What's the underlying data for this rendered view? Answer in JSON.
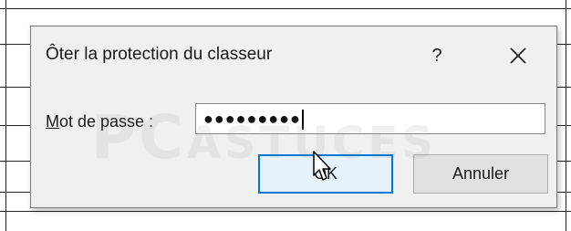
{
  "dialog": {
    "title": "Ôter la protection du classeur",
    "help_label": "?",
    "close_icon": "close-icon",
    "password": {
      "label_accel": "M",
      "label_rest": "ot de passe :",
      "value": "●●●●●●●●●"
    },
    "buttons": {
      "ok": "OK",
      "cancel": "Annuler"
    }
  },
  "watermark": {
    "big": "PC",
    "small": "ASTUCES"
  },
  "colors": {
    "dialog_bg": "#f0f0f0",
    "accent": "#0078d7",
    "ok_bg": "#e5f1fb"
  }
}
